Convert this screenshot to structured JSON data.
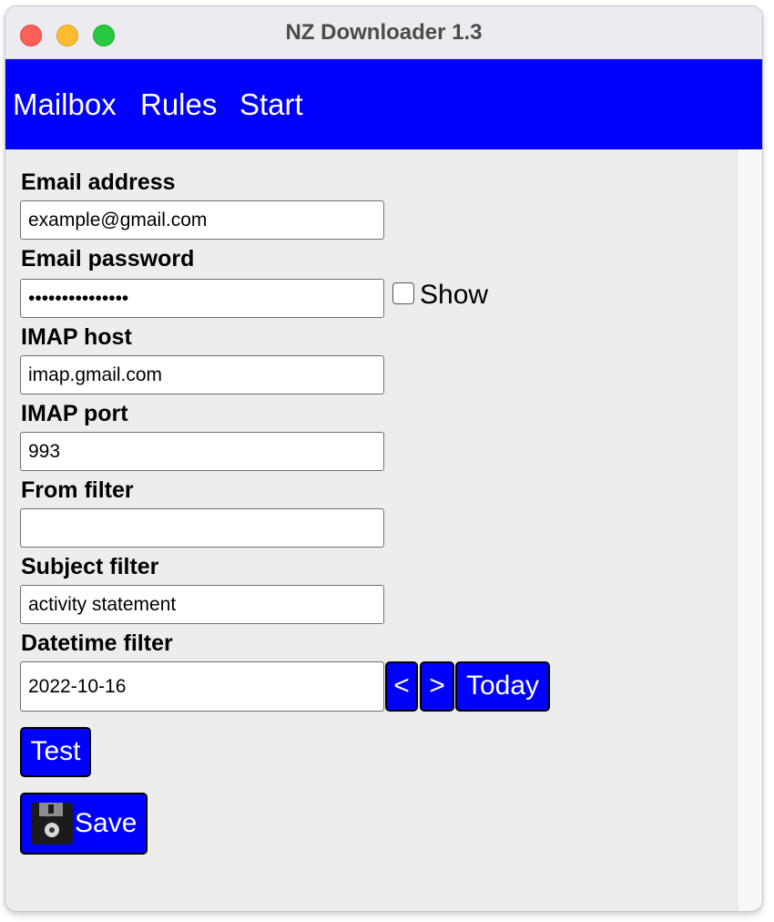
{
  "window": {
    "title": "NZ Downloader 1.3"
  },
  "nav": {
    "items": [
      "Mailbox",
      "Rules",
      "Start"
    ],
    "background": "#0000ff"
  },
  "form": {
    "email": {
      "label": "Email address",
      "value": "example@gmail.com"
    },
    "password": {
      "label": "Email password",
      "value": "•••••••••••••••",
      "show_label": "Show",
      "show_checked": false
    },
    "imap_host": {
      "label": "IMAP host",
      "value": "imap.gmail.com"
    },
    "imap_port": {
      "label": "IMAP port",
      "value": "993"
    },
    "from_filter": {
      "label": "From filter",
      "value": ""
    },
    "subject_filter": {
      "label": "Subject filter",
      "value": "activity statement"
    },
    "datetime_filter": {
      "label": "Datetime filter",
      "value": "2022-10-16",
      "prev_label": "<",
      "next_label": ">",
      "today_label": "Today"
    }
  },
  "actions": {
    "test_label": "Test",
    "save_label": "Save",
    "save_icon": "floppy-disk-icon"
  },
  "colors": {
    "accent": "#0000ff",
    "button_text": "#ffffff",
    "content_bg": "#ededed"
  }
}
